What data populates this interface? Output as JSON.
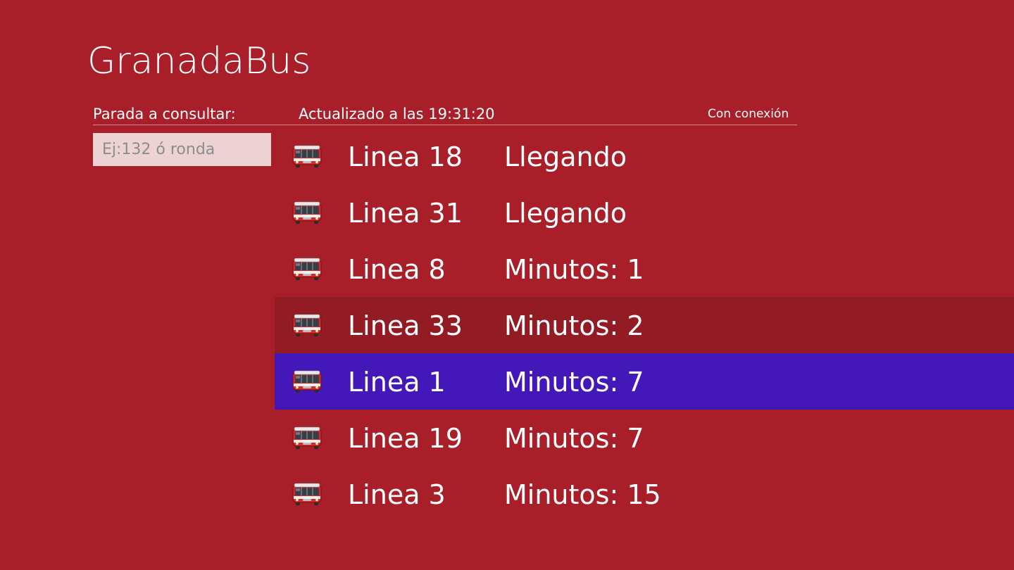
{
  "app": {
    "title": "GranadaBus"
  },
  "header": {
    "stop_label": "Parada a consultar:",
    "updated_label": "Actualizado a las 19:31:20",
    "connection_status": "Con conexión"
  },
  "search": {
    "placeholder": "Ej:132 ó ronda",
    "value": ""
  },
  "colors": {
    "background": "#a81f2a",
    "row_hover": "#931b24",
    "row_selected": "#4317b8",
    "search_bg": "#ecd2d3"
  },
  "arrivals": [
    {
      "line": "Linea 18",
      "time": "Llegando",
      "icon": "bus-icon",
      "state": "normal"
    },
    {
      "line": "Linea 31",
      "time": "Llegando",
      "icon": "bus-icon",
      "state": "normal"
    },
    {
      "line": "Linea 8",
      "time": "Minutos: 1",
      "icon": "bus-icon",
      "state": "normal"
    },
    {
      "line": "Linea 33",
      "time": "Minutos: 2",
      "icon": "bus-icon",
      "state": "hover"
    },
    {
      "line": "Linea 1",
      "time": "Minutos: 7",
      "icon": "bus-icon",
      "state": "selected"
    },
    {
      "line": "Linea 19",
      "time": "Minutos: 7",
      "icon": "bus-icon",
      "state": "normal"
    },
    {
      "line": "Linea 3",
      "time": "Minutos: 15",
      "icon": "bus-icon",
      "state": "normal"
    }
  ]
}
